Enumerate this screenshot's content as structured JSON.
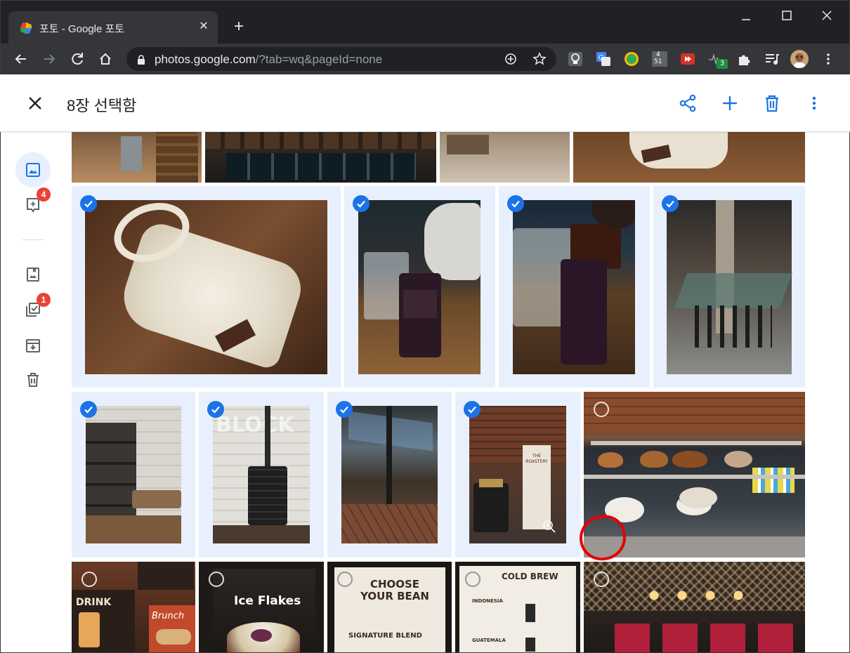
{
  "browser": {
    "tab_title": "포토 - Google 포토",
    "url_host": "photos.google.com",
    "url_path": "/?tab=wq&pageId=none",
    "extension_badge": "3",
    "calendar_ext_top": "4",
    "calendar_ext_bottom": "51"
  },
  "header": {
    "title": "8장 선택함"
  },
  "sidenav": {
    "badge_for_you": "4",
    "badge_utilities": "1"
  },
  "photos": {
    "cafe_sign_1": "BLOCK",
    "stand_title": "THE ROASTERY",
    "menu_drink": "DRINK",
    "menu_brunch": "Brunch",
    "poster_flakes": "Ice Flakes",
    "poster_choose": "CHOOSE YOUR BEAN",
    "poster_signature": "SIGNATURE BLEND",
    "poster_coldbrew": "COLD BREW",
    "poster_indonesia": "INDONESIA",
    "poster_guatemala": "GUATEMALA"
  },
  "colors": {
    "accent": "#1a73e8",
    "selected_bg": "#e8f0fe",
    "badge": "#ea4335",
    "annotation": "#e50000"
  }
}
